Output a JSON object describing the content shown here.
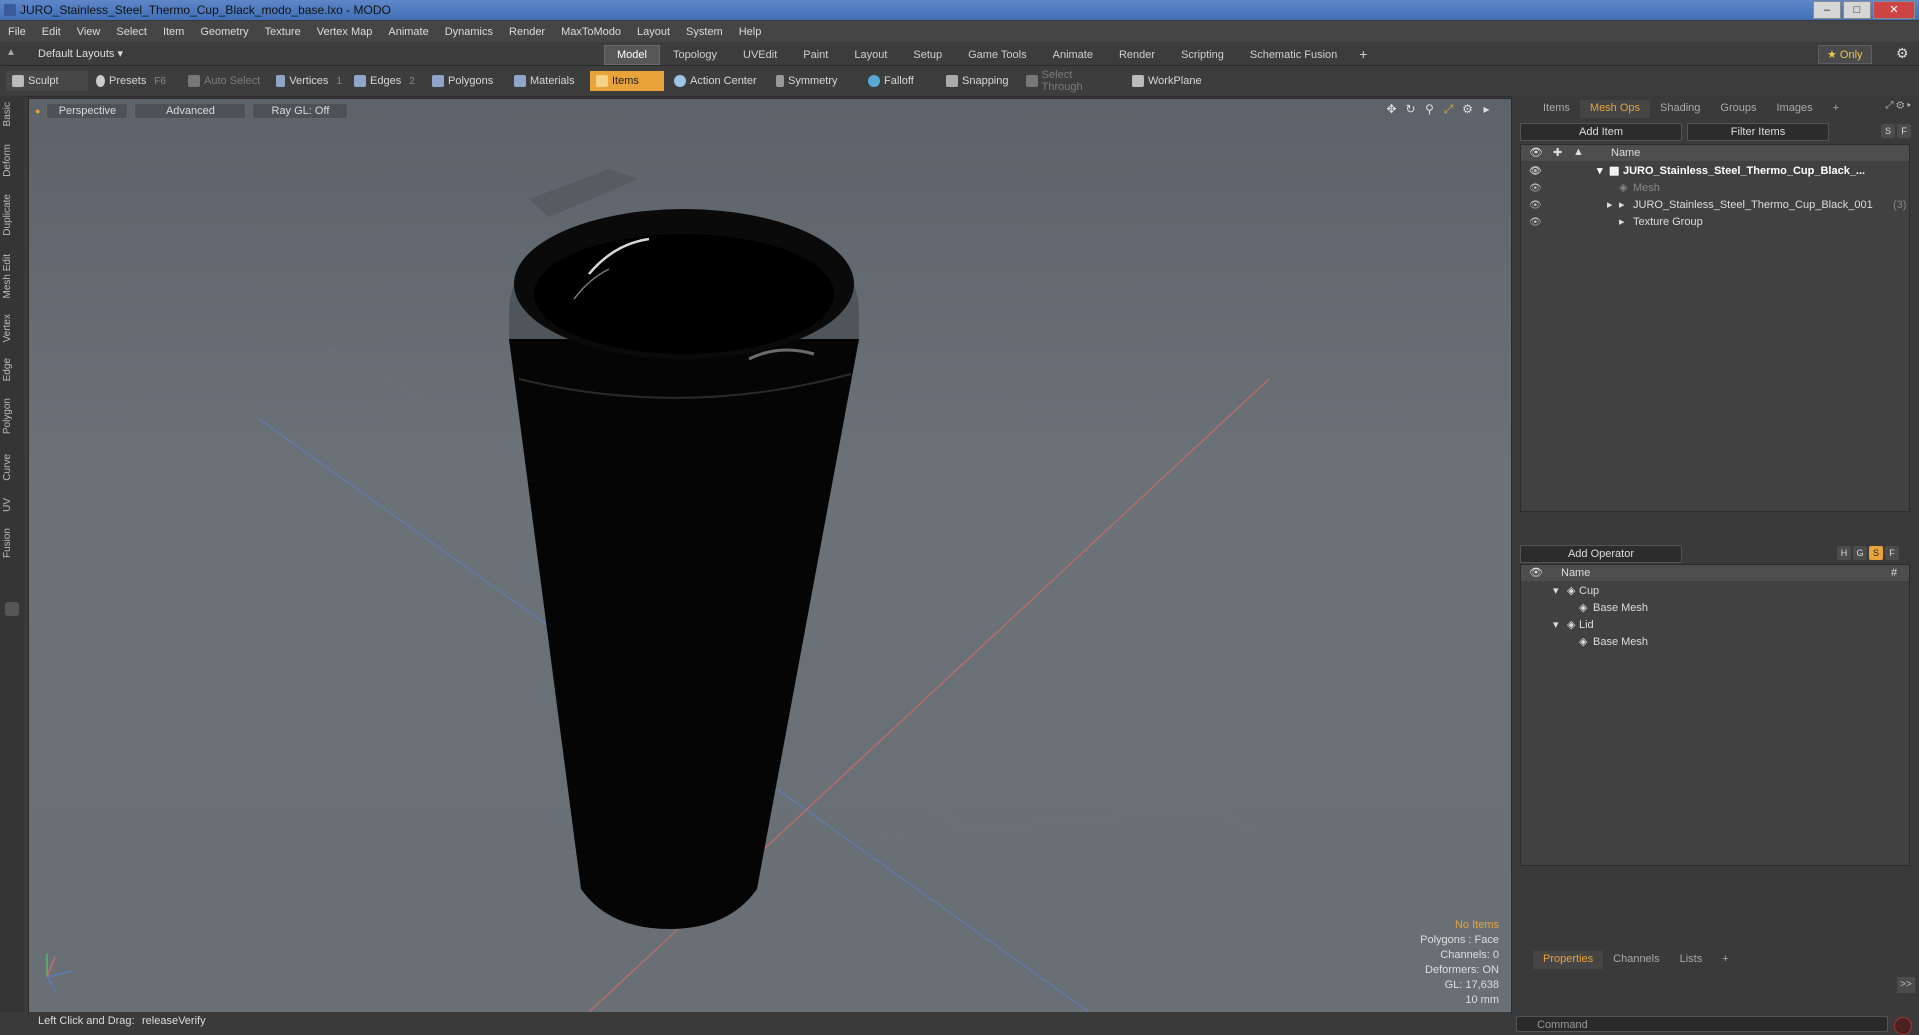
{
  "window": {
    "title": "JURO_Stainless_Steel_Thermo_Cup_Black_modo_base.lxo - MODO",
    "buttons": [
      "–",
      "□",
      "✕"
    ]
  },
  "menu": [
    "File",
    "Edit",
    "View",
    "Select",
    "Item",
    "Geometry",
    "Texture",
    "Vertex Map",
    "Animate",
    "Dynamics",
    "Render",
    "MaxToModo",
    "Layout",
    "System",
    "Help"
  ],
  "layout": {
    "selector": "Default Layouts ▾",
    "tabs": [
      "Model",
      "Topology",
      "UVEdit",
      "Paint",
      "Layout",
      "Setup",
      "Game Tools",
      "Animate",
      "Render",
      "Scripting",
      "Schematic Fusion"
    ],
    "active_tab": "Model",
    "add": "+",
    "only": "★ Only",
    "gear": "⚙"
  },
  "toolbar": {
    "sculpt": "Sculpt",
    "presets": "Presets",
    "presets_key": "F6",
    "auto_select": "Auto Select",
    "vertices": "Vertices",
    "vertices_key": "1",
    "edges": "Edges",
    "edges_key": "2",
    "polygons": "Polygons",
    "materials": "Materials",
    "items": "Items",
    "action_center": "Action Center",
    "symmetry": "Symmetry",
    "falloff": "Falloff",
    "snapping": "Snapping",
    "select_through": "Select Through",
    "workplane": "WorkPlane"
  },
  "left_tabs": [
    "Basic",
    "Deform",
    "Duplicate",
    "Mesh Edit",
    "Vertex",
    "Edge",
    "Polygon",
    "Curve",
    "UV",
    "Fusion"
  ],
  "viewport": {
    "view": "Perspective",
    "shading": "Advanced",
    "raygl": "Ray GL: Off",
    "stats": {
      "items": "No Items",
      "polygons": "Polygons : Face",
      "channels": "Channels: 0",
      "deformers": "Deformers: ON",
      "gl": "GL: 17,638",
      "scale": "10 mm"
    }
  },
  "status": {
    "label": "Left Click and Drag:",
    "value": "releaseVerify"
  },
  "items_panel": {
    "tabs": [
      "Items",
      "Mesh Ops",
      "Shading",
      "Groups",
      "Images",
      "+"
    ],
    "active_tab": "Mesh Ops",
    "add_item": "Add Item",
    "filter": "Filter Items",
    "s_btn": "S",
    "f_btn": "F",
    "column": "Name",
    "rows": [
      {
        "label": "JURO_Stainless_Steel_Thermo_Cup_Black_...",
        "bold": true
      },
      {
        "label": "Mesh",
        "dim": true
      },
      {
        "label": "JURO_Stainless_Steel_Thermo_Cup_Black_001",
        "count": "(3)"
      },
      {
        "label": "Texture Group"
      }
    ]
  },
  "meshops_panel": {
    "add_operator": "Add Operator",
    "btns": [
      "H",
      "G",
      "S",
      "F"
    ],
    "column": "Name",
    "hash": "#",
    "rows": [
      {
        "label": "Cup",
        "level": 0
      },
      {
        "label": "Base Mesh",
        "level": 1
      },
      {
        "label": "Lid",
        "level": 0
      },
      {
        "label": "Base Mesh",
        "level": 1
      }
    ]
  },
  "properties_panel": {
    "tabs": [
      "Properties",
      "Channels",
      "Lists",
      "+"
    ],
    "active_tab": "Properties",
    "expand": ">>"
  },
  "command": {
    "placeholder": "Command"
  }
}
